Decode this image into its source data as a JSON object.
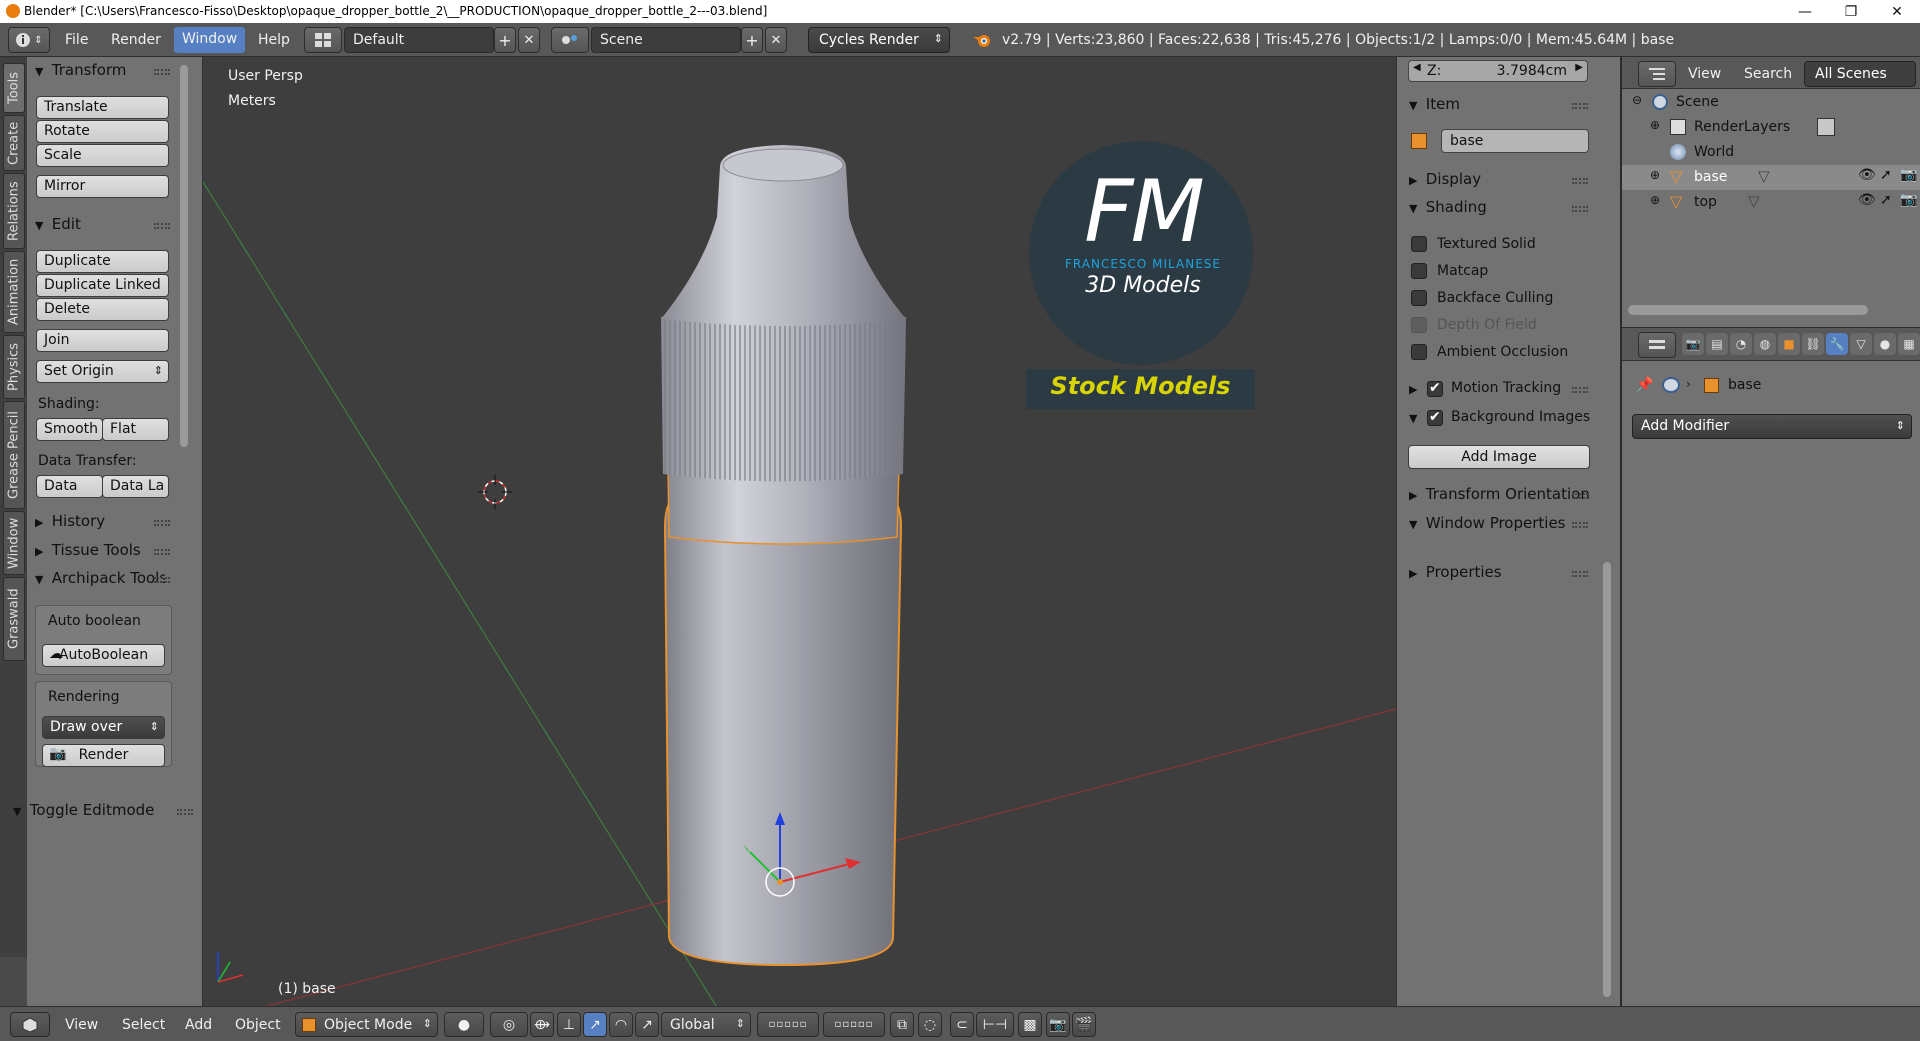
{
  "window": {
    "title": "Blender* [C:\\Users\\Francesco-Fisso\\Desktop\\opaque_dropper_bottle_2\\__PRODUCTION\\opaque_dropper_bottle_2---03.blend]",
    "minimize": "—",
    "maximize": "❐",
    "close": "✕"
  },
  "header": {
    "menus": [
      "File",
      "Render",
      "Window",
      "Help"
    ],
    "active_menu": "Window",
    "layout": "Default",
    "scene": "Scene",
    "engine": "Cycles Render",
    "stats": "v2.79 | Verts:23,860 | Faces:22,638 | Tris:45,276 | Objects:1/2 | Lamps:0/0 | Mem:45.64M | base"
  },
  "tabs": [
    "Tools",
    "Create",
    "Relations",
    "Animation",
    "Physics",
    "Grease Pencil",
    "Window",
    "Graswald"
  ],
  "toolshelf": {
    "transform": {
      "title": "Transform",
      "buttons": [
        "Translate",
        "Rotate",
        "Scale",
        "Mirror"
      ]
    },
    "edit": {
      "title": "Edit",
      "buttons": [
        "Duplicate",
        "Duplicate Linked",
        "Delete",
        "Join"
      ],
      "set_origin": "Set Origin",
      "shading_label": "Shading:",
      "smooth": "Smooth",
      "flat": "Flat",
      "data_transfer_label": "Data Transfer:",
      "data": "Data",
      "data_layers": "Data La"
    },
    "history": "History",
    "tissue": "Tissue Tools",
    "archipack": {
      "title": "Archipack Tools",
      "auto_boolean_label": "Auto boolean",
      "auto_boolean_btn": "AutoBoolean",
      "rendering_label": "Rendering",
      "draw_over": "Draw over",
      "render": "Render"
    },
    "toggle_editmode": "Toggle Editmode"
  },
  "viewport": {
    "view_name": "User Persp",
    "units": "Meters",
    "object_label": "(1) base",
    "logo": {
      "initials": "FM",
      "name": "FRANCESCO MILANESE",
      "tagline": "3D Models",
      "banner": "Stock Models"
    }
  },
  "npanel": {
    "z_label": "Z:",
    "z_value": "3.7984cm",
    "item": "Item",
    "item_name": "base",
    "display": "Display",
    "shading": "Shading",
    "shading_options": [
      {
        "label": "Textured Solid",
        "checked": false,
        "enabled": true
      },
      {
        "label": "Matcap",
        "checked": false,
        "enabled": true
      },
      {
        "label": "Backface Culling",
        "checked": false,
        "enabled": true
      },
      {
        "label": "Depth Of Field",
        "checked": false,
        "enabled": false
      },
      {
        "label": "Ambient Occlusion",
        "checked": false,
        "enabled": true
      }
    ],
    "motion_tracking": "Motion Tracking",
    "background_images": "Background Images",
    "add_image": "Add Image",
    "transform_orientations": "Transform Orientations",
    "window_properties": "Window Properties",
    "properties": "Properties"
  },
  "outliner": {
    "view": "View",
    "search": "Search",
    "all_scenes": "All Scenes",
    "tree": [
      "Scene",
      "RenderLayers",
      "World",
      "base",
      "top"
    ]
  },
  "props": {
    "object_name": "base",
    "add_modifier": "Add Modifier"
  },
  "footer": {
    "menus": [
      "View",
      "Select",
      "Add",
      "Object"
    ],
    "mode": "Object Mode",
    "orientation": "Global"
  },
  "colors": {
    "accent": "#5680c2",
    "selection": "#e8912d",
    "logo_blue": "#1ea3dd",
    "banner_yellow": "#d8d400"
  }
}
